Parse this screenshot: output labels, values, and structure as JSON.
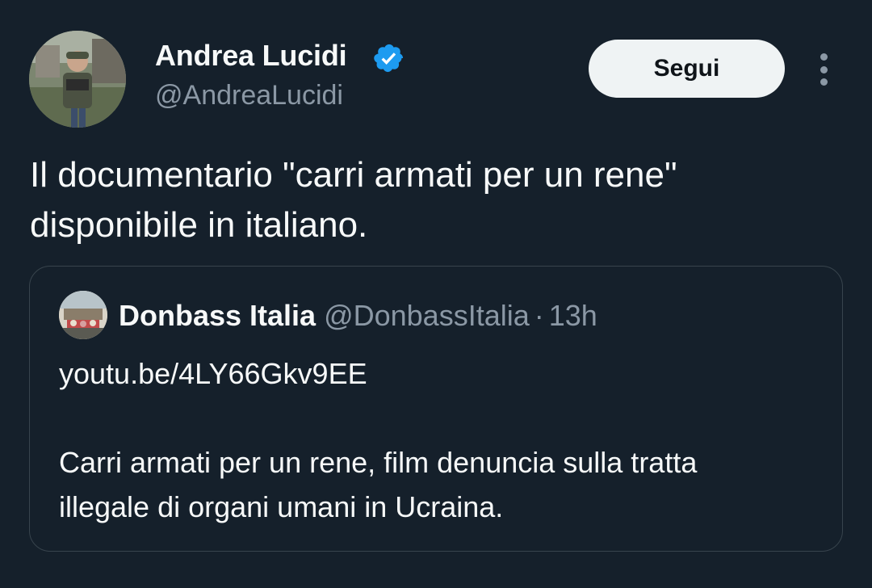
{
  "tweet": {
    "author": {
      "name": "Andrea Lucidi",
      "handle": "@AndreaLucidi",
      "verified": true,
      "avatar_icon": "profile-photo"
    },
    "follow_label": "Segui",
    "more_icon": "vertical-ellipsis-icon",
    "text_line1": "Il documentario \"carri armati per un rene\"",
    "text_line2": "disponibile in italiano."
  },
  "quote": {
    "author_name": "Donbass Italia",
    "author_handle": "@DonbassItalia",
    "separator": "·",
    "time": "13h",
    "link": "youtu.be/4LY66Gkv9EE",
    "body_line1": "Carri armati per un rene, film denuncia sulla tratta",
    "body_line2": "illegale di organi umani in Ucraina."
  },
  "colors": {
    "background": "#15202b",
    "text_primary": "#f7f9f9",
    "text_secondary": "#8b98a5",
    "verified_badge": "#1d9bf0",
    "border": "#38444d",
    "follow_button_bg": "#eff3f4"
  }
}
